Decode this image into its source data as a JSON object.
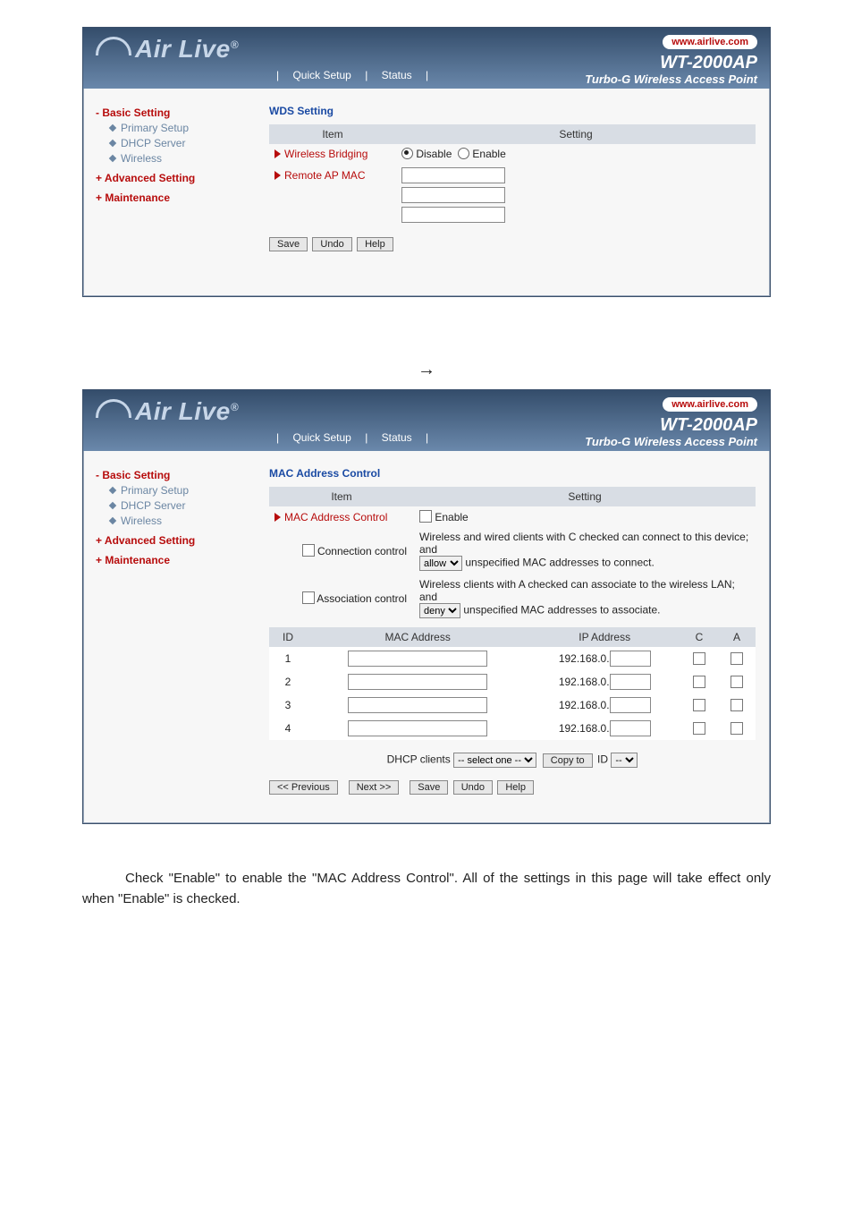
{
  "hdr": {
    "logo": "Air Live",
    "reg": "®",
    "url": "www.airlive.com",
    "model": "WT-2000AP",
    "tag": "Turbo-G Wireless Access Point",
    "tab1": "Quick Setup",
    "tab2": "Status",
    "pipe": "|"
  },
  "side": {
    "basic": "- Basic Setting",
    "ps": "Primary Setup",
    "dhcp": "DHCP Server",
    "wl": "Wireless",
    "adv": "+ Advanced Setting",
    "mnt": "+ Maintenance"
  },
  "wds": {
    "title": "WDS Setting",
    "item": "Item",
    "setting": "Setting",
    "wb": "Wireless Bridging",
    "dis": "Disable",
    "en": "Enable",
    "rap": "Remote AP MAC"
  },
  "btn": {
    "save": "Save",
    "undo": "Undo",
    "help": "Help",
    "prev": "<< Previous",
    "next": "Next >>",
    "copy": "Copy to",
    "id": "ID"
  },
  "mac": {
    "title": "MAC Address Control",
    "item": "Item",
    "setting": "Setting",
    "macctrl": "MAC Address Control",
    "enable": "Enable",
    "conn": "Connection control",
    "connt1": "Wireless and wired clients with C checked can connect to this device; and",
    "connsel": "allow",
    "connt2": "unspecified MAC addresses to connect.",
    "assoc": "Association control",
    "assoct1": "Wireless clients with A checked can associate to the wireless LAN; and",
    "assosel": "deny",
    "assoct2": "unspecified MAC addresses to associate.",
    "colid": "ID",
    "colmac": "MAC Address",
    "colip": "IP Address",
    "colc": "C",
    "cola": "A",
    "ipp": "192.168.0.",
    "dhcp": "DHCP clients",
    "selone": "-- select one --",
    "sep": "--"
  },
  "foot": {
    "p1": "Check \"Enable\" to enable the \"MAC Address Control\". All of the settings in this page will take effect only when \"Enable\" is checked."
  }
}
